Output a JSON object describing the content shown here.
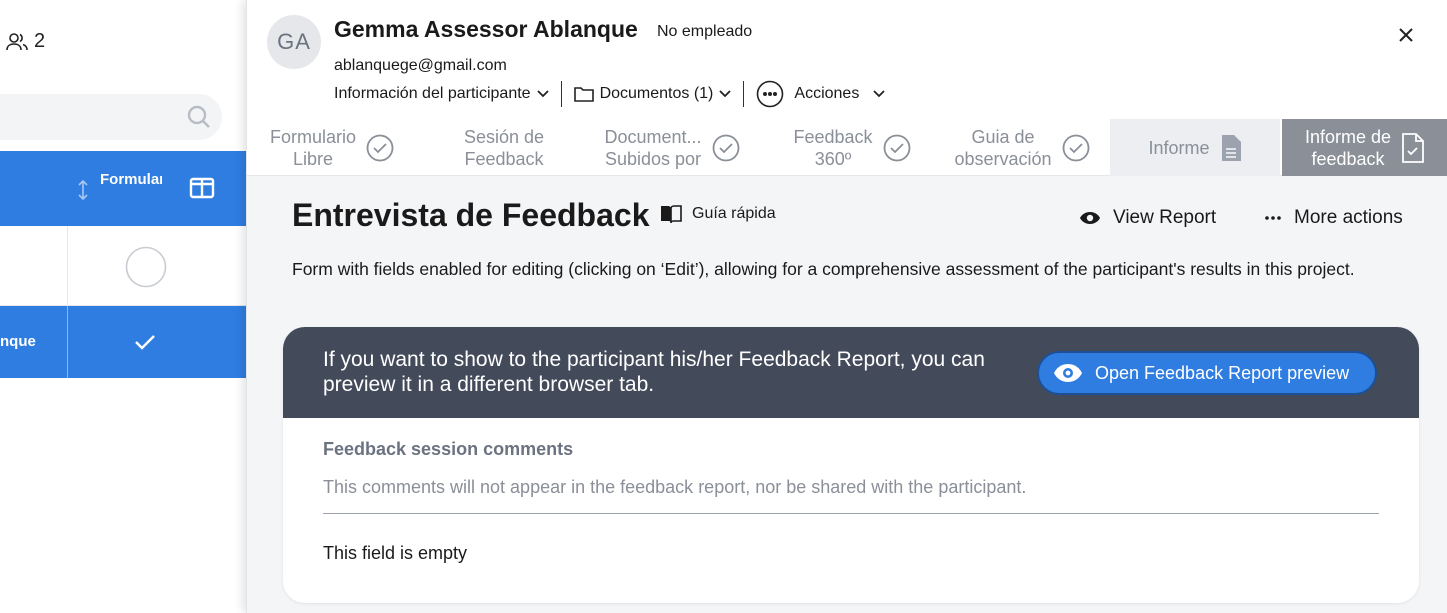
{
  "left_panel": {
    "participants_count": "2",
    "column_header": "Formulario Libre",
    "row_name_fragment": "nque"
  },
  "participant": {
    "initials": "GA",
    "name": "Gemma Assessor Ablanque",
    "status": "No empleado",
    "email": "ablanquege@gmail.com"
  },
  "menus": {
    "info": "Información del participante",
    "documents": "Documentos (1)",
    "actions": "Acciones"
  },
  "tabs": [
    {
      "line1": "Formulario",
      "line2": "Libre"
    },
    {
      "line1": "Sesión de",
      "line2": "Feedback"
    },
    {
      "line1": "Document...",
      "line2": "Subidos por"
    },
    {
      "line1": "Feedback",
      "line2": "360º"
    },
    {
      "line1": "Guia de",
      "line2": "observación"
    },
    {
      "line1": "Informe",
      "line2": ""
    },
    {
      "line1": "Informe de",
      "line2": "feedback"
    }
  ],
  "content": {
    "title": "Entrevista de Feedback",
    "quick_guide": "Guía rápida",
    "view_report": "View Report",
    "more_actions": "More actions",
    "description": "Form with fields enabled for editing (clicking on ‘Edit’), allowing for a comprehensive assessment of the participant's results in this project."
  },
  "card": {
    "banner_text": "If you want to show to the participant his/her Feedback Report, you can preview it in a different browser tab.",
    "preview_button": "Open Feedback Report preview",
    "field_label": "Feedback session comments",
    "field_help": "This comments will not appear in the feedback report, nor be shared with the participant.",
    "field_value": "This field is empty"
  },
  "colors": {
    "accent": "#2f7de1",
    "banner": "#434a5a",
    "active_tab": "#8a8f98",
    "muted_text": "#8a8f98"
  }
}
